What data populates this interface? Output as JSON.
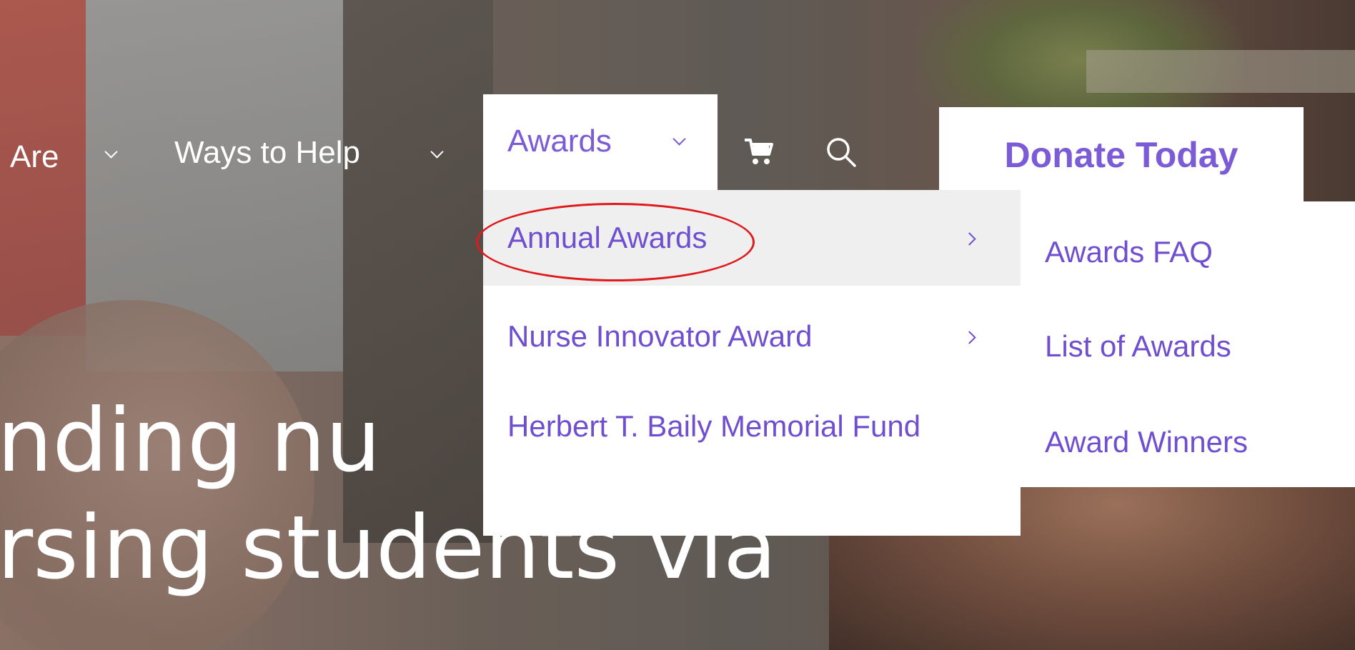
{
  "nav": {
    "items": [
      {
        "label": "Are"
      },
      {
        "label": "Ways to Help"
      },
      {
        "label": "Awards"
      }
    ],
    "donate_label": "Donate Today"
  },
  "awards_dropdown": {
    "items": [
      {
        "label": "Annual Awards"
      },
      {
        "label": "Nurse Innovator Award"
      },
      {
        "label": "Herbert T. Baily Memorial Fund"
      }
    ]
  },
  "submenu": {
    "items": [
      {
        "label": "Awards FAQ"
      },
      {
        "label": "List of Awards"
      },
      {
        "label": "Award Winners"
      }
    ]
  },
  "hero": {
    "headline_line1": "nding nu",
    "headline_line2": "rsing students via"
  },
  "colors": {
    "accent": "#7b5bd6",
    "menu_text": "#6f4fcf",
    "highlight_bg": "#efefef",
    "annotation": "#e01a1a"
  },
  "icons": [
    "chevron-down-icon",
    "cart-icon",
    "search-icon",
    "chevron-right-icon"
  ]
}
